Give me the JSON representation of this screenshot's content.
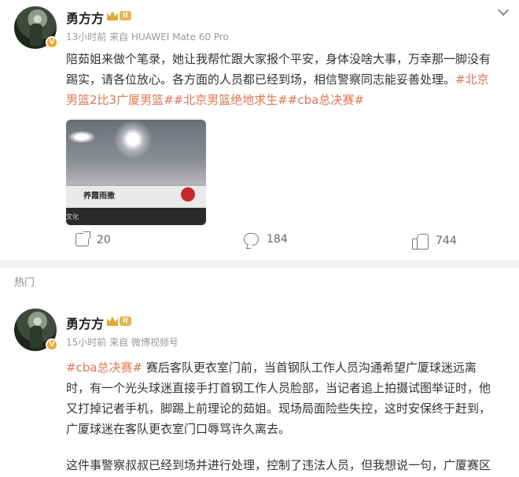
{
  "post1": {
    "author": "勇方方",
    "level": "II",
    "time": "13小时前",
    "source": "来自 HUAWEI Mate 60 Pro",
    "text_line1": "陪茹姐来做个笔录，她让我帮忙跟大家报个平安，身体没啥大事，万幸那一脚没有",
    "text_line2_plain": "踢实，请各位放心。各方面的人员都已经到场，相信警察同志能妥善处理。",
    "tag1_part1": "#北京",
    "tag1_part2": "男篮2比3广厦男篮#",
    "tag2": "#北京男篮绝地求生#",
    "tag3": "#cba总决赛#",
    "photo_sign": "养霞雨撒",
    "photo_label": "文化",
    "shares": "20",
    "comments": "184",
    "likes": "744"
  },
  "section_label": "热门",
  "post2": {
    "author": "勇方方",
    "level": "II",
    "time": "15小时前",
    "source": "来自 微博视频号",
    "tag": "#cba总决赛#",
    "line1_rest": " 赛后客队更衣室门前，当首钢队工作人员沟通希望广厦球迷远离",
    "line2": "时，有一个光头球迷直接手打首钢工作人员脸部，当记者追上拍摄试图举证时，他",
    "line3": "又打掉记者手机，脚踢上前理论的茹姐。现场局面险些失控，这时安保终于赶到，",
    "line4": "广厦球迷在客队更衣室门口辱骂许久离去。",
    "line5": "这件事警察叔叔已经到场并进行处理，控制了违法人员，但我想说一句，广厦赛区"
  },
  "colors": {
    "tag": "#eb7350",
    "meta": "#999999",
    "badge": "#f5a623"
  }
}
